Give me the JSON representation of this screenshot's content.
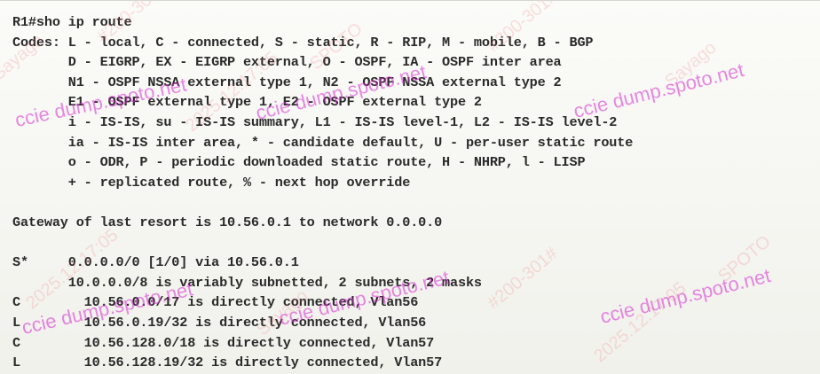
{
  "terminal": {
    "lines": [
      "R1#sho ip route",
      "Codes: L - local, C - connected, S - static, R - RIP, M - mobile, B - BGP",
      "       D - EIGRP, EX - EIGRP external, O - OSPF, IA - OSPF inter area",
      "       N1 - OSPF NSSA external type 1, N2 - OSPF NSSA external type 2",
      "       E1 - OSPF external type 1, E2 - OSPF external type 2",
      "       i - IS-IS, su - IS-IS summary, L1 - IS-IS level-1, L2 - IS-IS level-2",
      "       ia - IS-IS inter area, * - candidate default, U - per-user static route",
      "       o - ODR, P - periodic downloaded static route, H - NHRP, l - LISP",
      "       + - replicated route, % - next hop override",
      "",
      "Gateway of last resort is 10.56.0.1 to network 0.0.0.0",
      "",
      "S*     0.0.0.0/0 [1/0] via 10.56.0.1",
      "       10.0.0.0/8 is variably subnetted, 2 subnets, 2 masks",
      "C        10.56.0.0/17 is directly connected, Vlan56",
      "L        10.56.0.19/32 is directly connected, Vlan56",
      "C        10.56.128.0/18 is directly connected, Vlan57",
      "L        10.56.128.19/32 is directly connected, Vlan57"
    ]
  },
  "watermark": {
    "brand": "ccie dump.spoto.net",
    "brand_alt": "ccie dump.spoto.net",
    "brand_alt2": "ccie dump.spoto.net",
    "brand_alt3": "ccie dump.spoto.net",
    "brand_alt4": "ccie dump.spoto.net",
    "faint_a": "#200-301#",
    "faint_b": "2025.12.17:05",
    "faint_c": "Sayago",
    "faint_d": "SPOTO"
  },
  "colors": {
    "watermark_brand": "#d728d2",
    "terminal_text": "#2a2a2a",
    "background": "#f7f7f4"
  }
}
